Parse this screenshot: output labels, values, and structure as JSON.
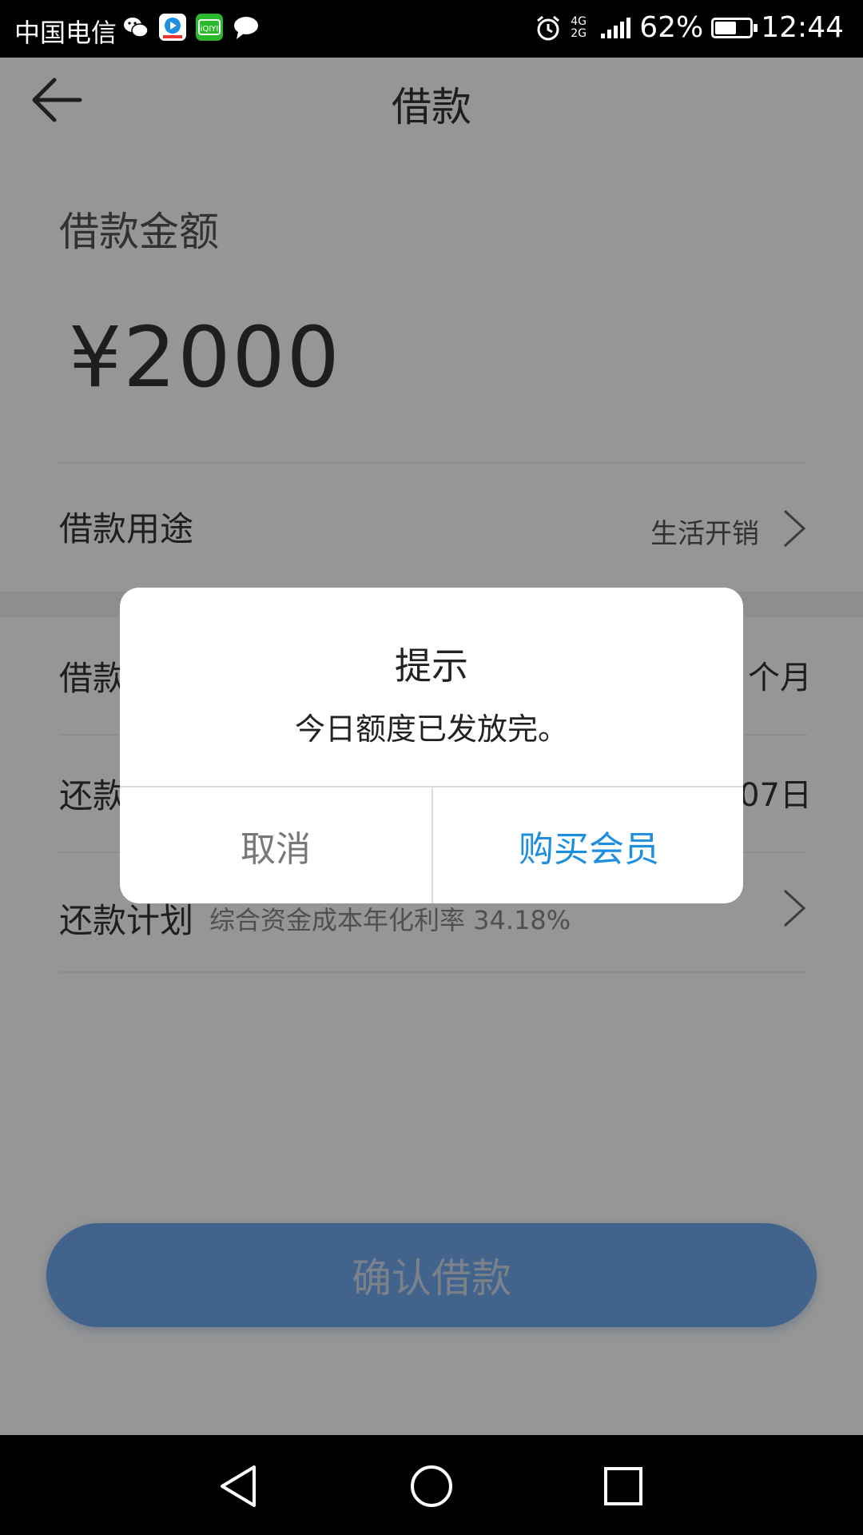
{
  "status_bar": {
    "carrier": "中国电信",
    "network": "4G 2G",
    "battery": "62%",
    "battery_level": 0.62,
    "time": "12:44",
    "app_icons": [
      "wechat-icon",
      "video-app-icon",
      "iqiyi-icon",
      "message-icon"
    ],
    "alarm_icon": "alarm-icon"
  },
  "header": {
    "title": "借款",
    "back_icon": "back-arrow-icon"
  },
  "loan": {
    "amount_label": "借款金额",
    "amount": "¥2000",
    "purpose_label": "借款用途",
    "purpose_value": "生活开销",
    "term_label_partial": "借款",
    "term_value_partial": "个月",
    "repay_label_partial": "还款",
    "repay_value_partial": "07日",
    "plan_label": "还款计划",
    "plan_rate": "综合资金成本年化利率  34.18%"
  },
  "confirm_button": "确认借款",
  "dialog": {
    "title": "提示",
    "message": "今日额度已发放完。",
    "cancel": "取消",
    "buy": "购买会员"
  },
  "colors": {
    "primary_blue": "#1e8fe0",
    "button_blue": "#6fa8ee",
    "overlay": "rgba(0,0,0,0.41)"
  },
  "nav_bar": [
    "back-nav-icon",
    "home-nav-icon",
    "recents-nav-icon"
  ]
}
